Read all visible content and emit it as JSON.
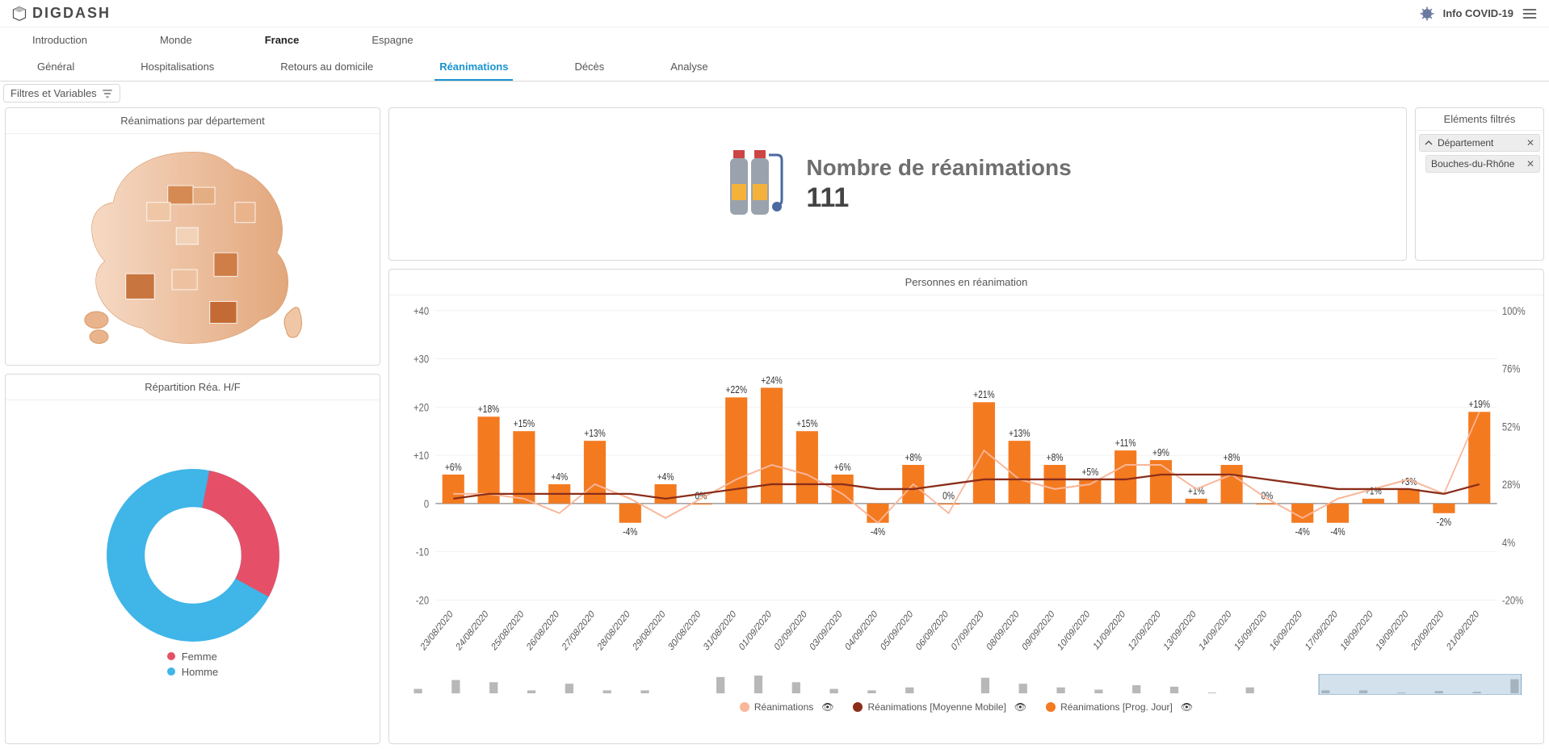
{
  "brand": "DIGDASH",
  "header_link": "Info COVID-19",
  "primary_tabs": [
    "Introduction",
    "Monde",
    "France",
    "Espagne"
  ],
  "primary_active": "France",
  "secondary_tabs": [
    "Général",
    "Hospitalisations",
    "Retours au domicile",
    "Réanimations",
    "Décès",
    "Analyse"
  ],
  "secondary_active": "Réanimations",
  "filterbar_label": "Filtres et Variables",
  "map_panel": {
    "title": "Réanimations par département"
  },
  "donut_panel": {
    "title": "Répartition Réa. H/F",
    "legend": [
      {
        "label": "Femme",
        "color": "#e55068"
      },
      {
        "label": "Homme",
        "color": "#3fb5e8"
      }
    ]
  },
  "kpi": {
    "title": "Nombre de réanimations",
    "value": "111"
  },
  "filters_panel": {
    "title": "Eléments filtrés",
    "chips": [
      {
        "label": "Département",
        "expandable": true
      },
      {
        "label": "Bouches-du-Rhône",
        "expandable": false
      }
    ]
  },
  "chart_panel": {
    "title": "Personnes en réanimation",
    "legend": [
      {
        "label": "Réanimations",
        "color": "#f9b698"
      },
      {
        "label": "Réanimations [Moyenne Mobile]",
        "color": "#8a2e1a"
      },
      {
        "label": "Réanimations [Prog. Jour]",
        "color": "#f47a20"
      }
    ]
  },
  "chart_data": {
    "type": "bar+line",
    "title": "Personnes en réanimation",
    "xlabel": "",
    "y_left_label": "",
    "y_right_label": "",
    "y_left_lim": [
      -20,
      40
    ],
    "y_right_lim": [
      -20,
      100
    ],
    "y_left_ticks": [
      -20,
      -10,
      0,
      10,
      20,
      30,
      40
    ],
    "y_right_ticks": [
      -20,
      4,
      28,
      52,
      76,
      100
    ],
    "x_categories": [
      "23/08/2020",
      "24/08/2020",
      "25/08/2020",
      "26/08/2020",
      "27/08/2020",
      "28/08/2020",
      "29/08/2020",
      "30/08/2020",
      "31/08/2020",
      "01/09/2020",
      "02/09/2020",
      "03/09/2020",
      "04/09/2020",
      "05/09/2020",
      "06/09/2020",
      "07/09/2020",
      "08/09/2020",
      "09/09/2020",
      "10/09/2020",
      "11/09/2020",
      "12/09/2020",
      "13/09/2020",
      "14/09/2020",
      "15/09/2020",
      "16/09/2020",
      "17/09/2020",
      "18/09/2020",
      "19/09/2020",
      "20/09/2020",
      "21/09/2020"
    ],
    "series": [
      {
        "name": "Réanimations [Prog. Jour]",
        "axis": "left",
        "kind": "bar",
        "color": "#f47a20",
        "values": [
          6,
          18,
          15,
          4,
          13,
          -4,
          4,
          0,
          22,
          24,
          15,
          6,
          -4,
          8,
          0,
          21,
          13,
          8,
          5,
          11,
          9,
          1,
          8,
          0,
          -4,
          -4,
          1,
          3,
          -2,
          19
        ],
        "data_labels": [
          "+6%",
          "+18%",
          "+15%",
          "+4%",
          "+13%",
          "-4%",
          "+4%",
          "0%",
          "+22%",
          "+24%",
          "+15%",
          "+6%",
          "-4%",
          "+8%",
          "0%",
          "+21%",
          "+13%",
          "+8%",
          "+5%",
          "+11%",
          "+9%",
          "+1%",
          "+8%",
          "0%",
          "-4%",
          "-4%",
          "+1%",
          "+3%",
          "-2%",
          "+19%"
        ]
      },
      {
        "name": "Réanimations",
        "axis": "left",
        "kind": "line",
        "color": "#f9b698",
        "values": [
          2,
          2,
          1,
          -2,
          4,
          1,
          -3,
          1,
          5,
          8,
          6,
          2,
          -4,
          4,
          -2,
          11,
          5,
          3,
          4,
          8,
          8,
          3,
          6,
          1,
          -3,
          1,
          3,
          5,
          2,
          19
        ]
      },
      {
        "name": "Réanimations [Moyenne Mobile]",
        "axis": "left",
        "kind": "line",
        "color": "#8a2e1a",
        "values": [
          1,
          2,
          2,
          2,
          2,
          2,
          1,
          2,
          3,
          4,
          4,
          4,
          3,
          3,
          4,
          5,
          5,
          5,
          5,
          5,
          6,
          6,
          6,
          5,
          4,
          3,
          3,
          3,
          2,
          4
        ]
      }
    ],
    "donut": {
      "type": "pie",
      "title": "Répartition Réa. H/F",
      "slices": [
        {
          "label": "Femme",
          "value": 30,
          "color": "#e55068"
        },
        {
          "label": "Homme",
          "value": 70,
          "color": "#3fb5e8"
        }
      ]
    }
  }
}
